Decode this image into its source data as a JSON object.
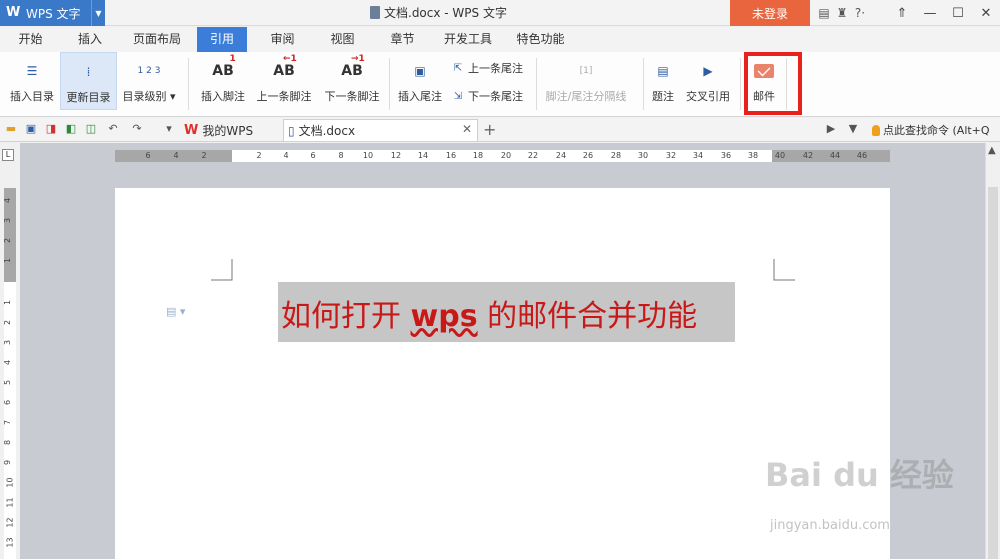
{
  "app": {
    "menu_label": "WPS 文字",
    "logo": "W",
    "window_title": "文档.docx - WPS 文字",
    "login_label": "未登录",
    "title_icons": [
      "skin-icon",
      "shirt-icon",
      "help-icon"
    ],
    "help_glyph": "?·"
  },
  "tabs": [
    "开始",
    "插入",
    "页面布局",
    "引用",
    "审阅",
    "视图",
    "章节",
    "开发工具",
    "特色功能"
  ],
  "active_tab": "引用",
  "ribbon": {
    "insert_toc": "插入目录",
    "update_toc": "更新目录",
    "toc_level": "目录级别",
    "insert_footnote": "插入脚注",
    "prev_footnote": "上一条脚注",
    "next_footnote": "下一条脚注",
    "insert_endnote": "插入尾注",
    "prev_endnote": "上一条尾注",
    "next_endnote": "下一条尾注",
    "footnote_separator": "脚注/尾注分隔线",
    "caption": "题注",
    "cross_reference": "交叉引用",
    "mail": "邮件",
    "ab_text": "AB",
    "sup_1": "1",
    "level_glyph": "1 2 3",
    "separator_glyph": "[1]"
  },
  "quickbar": {
    "my_wps_tab": "我的WPS",
    "doc_tab": "文档.docx",
    "find_command": "点此查找命令 (Alt+Q",
    "wps_logo": "W"
  },
  "ruler": {
    "h_ticks": [
      "6",
      "4",
      "2",
      "2",
      "4",
      "6",
      "8",
      "10",
      "12",
      "14",
      "16",
      "18",
      "20",
      "22",
      "24",
      "26",
      "28",
      "30",
      "32",
      "34",
      "36",
      "38",
      "40",
      "42",
      "44",
      "46"
    ],
    "v_ticks": [
      "4",
      "3",
      "2",
      "1",
      "1",
      "2",
      "3",
      "4",
      "5",
      "6",
      "7",
      "8",
      "9",
      "10",
      "11",
      "12",
      "13"
    ],
    "corner_glyph": "L"
  },
  "document": {
    "title_part1": "如何打开 ",
    "title_wps": "wps",
    "title_part2": " 的邮件合并功能"
  },
  "watermark": {
    "main": "Bai du 经验",
    "sub": "jingyan.baidu.com"
  },
  "colors": {
    "accent": "#3b7dd8",
    "login": "#e9653d",
    "highlight": "#e8211d",
    "title_text": "#c81818",
    "mail_icon": "#e9836c"
  }
}
